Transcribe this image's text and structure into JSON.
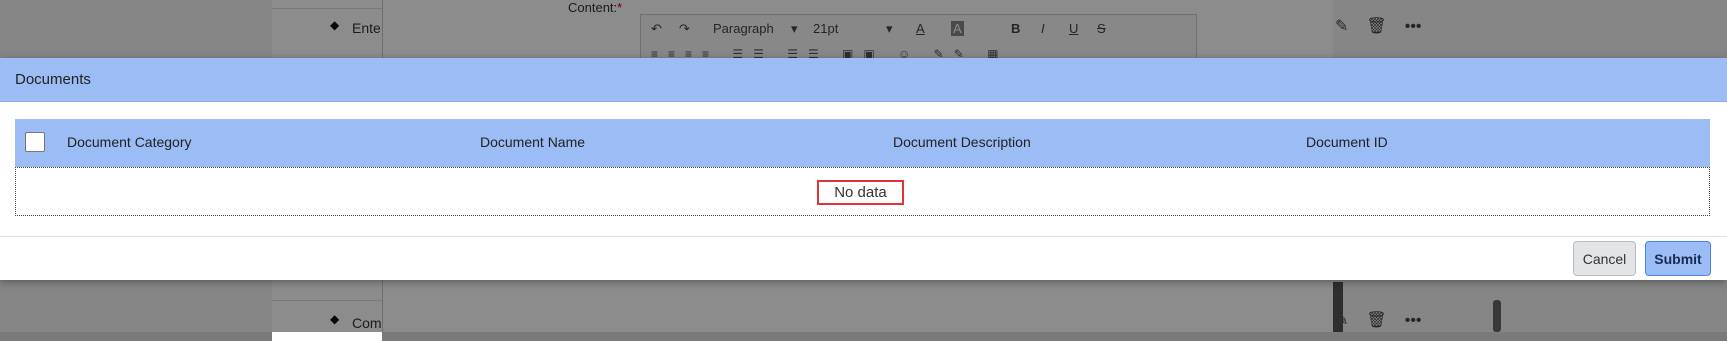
{
  "background": {
    "list_items": [
      "Ente",
      "Com"
    ],
    "content_label": "Content:",
    "required_mark": "*",
    "toolbar": {
      "paragraph_select": "Paragraph",
      "font_size_select": "21pt",
      "bold": "B",
      "italic": "I",
      "underline": "U",
      "strike": "S"
    }
  },
  "dialog": {
    "title": "Documents",
    "table": {
      "columns": [
        "Document Category",
        "Document Name",
        "Document Description",
        "Document ID"
      ],
      "empty_text": "No data"
    },
    "buttons": {
      "cancel": "Cancel",
      "submit": "Submit"
    }
  },
  "colors": {
    "header_bg": "#9cbcf5",
    "highlight_border": "#e0343a",
    "submit_border": "#4a84e8"
  }
}
